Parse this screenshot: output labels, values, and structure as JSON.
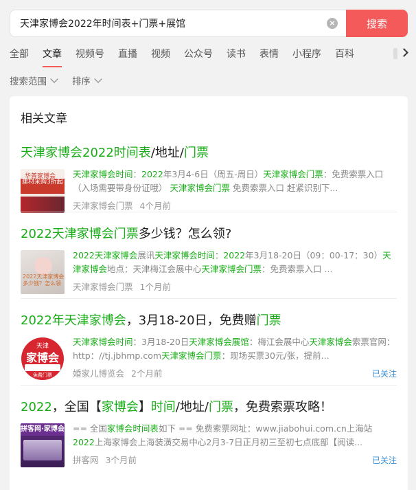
{
  "search": {
    "query": "天津家博会2022年时间表+门票+展馆",
    "button": "搜索"
  },
  "tabs": [
    "全部",
    "文章",
    "视频号",
    "直播",
    "视频",
    "公众号",
    "读书",
    "表情",
    "小程序",
    "百科"
  ],
  "active_tab": "文章",
  "filters": [
    "搜索范围",
    "排序"
  ],
  "section_title": "相关文章",
  "articles": [
    {
      "title_parts": [
        [
          "天津家博会2022时间表",
          1
        ],
        [
          "/地址/",
          0
        ],
        [
          "门票",
          1
        ]
      ],
      "desc_parts": [
        [
          "天津家博会时间",
          1
        ],
        [
          "：",
          0
        ],
        [
          "2022",
          1
        ],
        [
          "年3月4-6日（周五-周日）",
          0
        ],
        [
          "天津家博会门票",
          1
        ],
        [
          "：免费索票入口（入场需要带身份证哦） ",
          0
        ],
        [
          "天津家博会门票",
          1
        ],
        [
          " 免费索票入口 赶紧识别下...",
          0
        ]
      ],
      "source": "天津家博会门票",
      "time": "4个月前",
      "followed": "",
      "thumb_text": "华普家博会",
      "thumb_text2": "建材采购3折起"
    },
    {
      "title_parts": [
        [
          "2022天津家博会门票",
          1
        ],
        [
          "多少钱？怎么领?",
          0
        ]
      ],
      "desc_parts": [
        [
          "2022天津家博会",
          1
        ],
        [
          "展讯",
          0
        ],
        [
          "天津家博会时间",
          1
        ],
        [
          "：",
          0
        ],
        [
          "2022",
          1
        ],
        [
          "年3月18-20日（09：00-17：30）",
          0
        ],
        [
          "天津家博会",
          1
        ],
        [
          "地点：天津梅江会展中心",
          0
        ],
        [
          "天津家博会门票",
          1
        ],
        [
          "：免费索票入口 ...",
          0
        ]
      ],
      "source": "天津家博会门票",
      "time": "1个月前",
      "followed": "",
      "thumb_text": "2022天津家博会",
      "thumb_text2": "多少钱？怎么领"
    },
    {
      "title_parts": [
        [
          "2022年天津家博会",
          1
        ],
        [
          "，3月18-20日，免费赠",
          0
        ],
        [
          "门票",
          1
        ]
      ],
      "desc_parts": [
        [
          "天津家博会时间",
          1
        ],
        [
          "：3月18-20日",
          0
        ],
        [
          "天津家博会展馆",
          1
        ],
        [
          "：梅江会展中心",
          0
        ],
        [
          "天津家博会",
          1
        ],
        [
          "索票官网：http：//tj.jbhmp.com",
          0
        ],
        [
          "天津家博会门票",
          1
        ],
        [
          "：现场买票30元/张，提前...",
          0
        ]
      ],
      "source": "婚家儿博览会",
      "time": "2个月前",
      "followed": "已关注",
      "thumb_text": "天津",
      "thumb_text2": "家博会",
      "thumb_text3": "免费门票"
    },
    {
      "title_parts": [
        [
          "2022",
          1
        ],
        [
          "，全国【",
          0
        ],
        [
          "家博会",
          1
        ],
        [
          "】",
          0
        ],
        [
          "时间",
          1
        ],
        [
          "/地址/",
          0
        ],
        [
          "门票",
          1
        ],
        [
          "，免费索票攻略！",
          0
        ]
      ],
      "desc_parts": [
        [
          "== 全国",
          0
        ],
        [
          "家博会时间表",
          1
        ],
        [
          "如下 == 免费索票网址：www.jiabohui.com.cn上海站 ",
          0
        ],
        [
          "2022",
          1
        ],
        [
          "上海家博会上海装潢交易中心2月3-7日正月初三至初七点底部【阅读...",
          0
        ]
      ],
      "source": "拼客网",
      "time": "3个月前",
      "followed": "已关注",
      "thumb_text": "拼客网·家博会"
    }
  ]
}
